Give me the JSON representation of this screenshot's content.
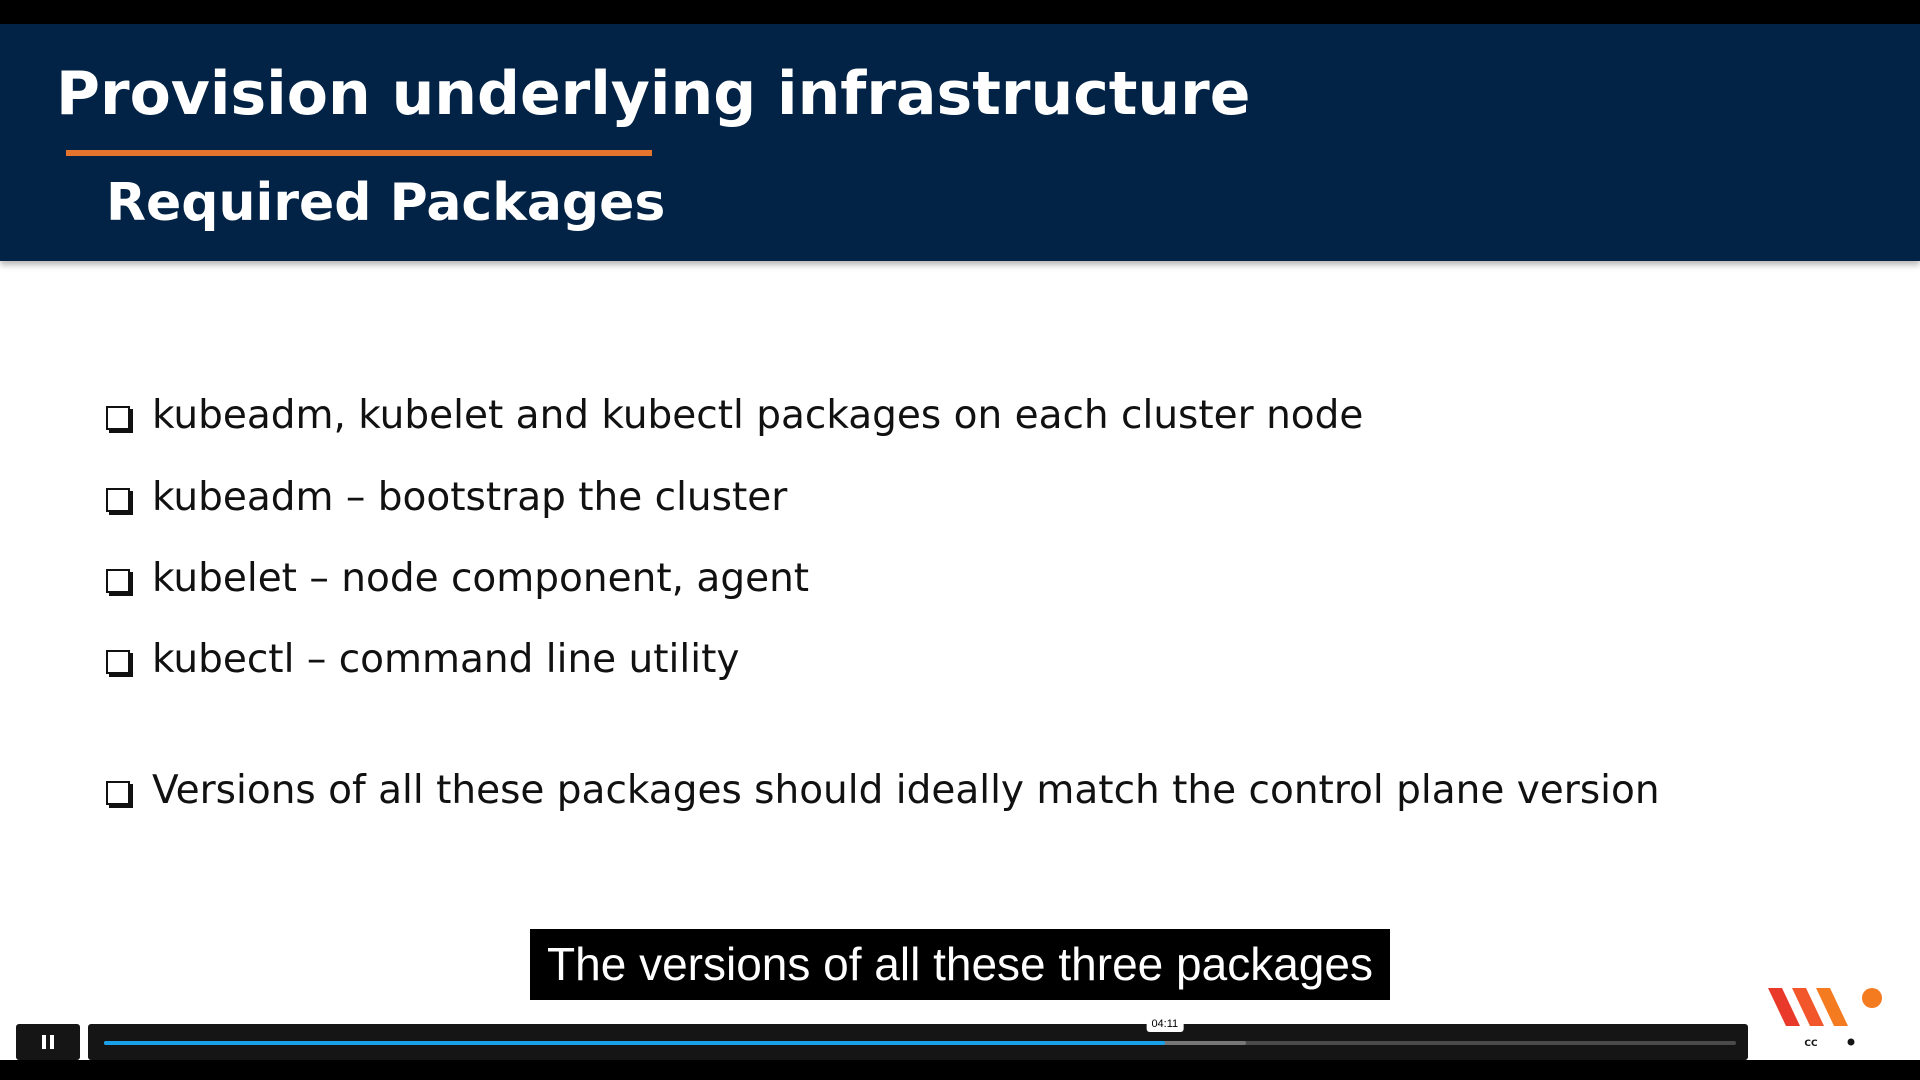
{
  "slide": {
    "title": "Provision underlying infrastructure",
    "subtitle": "Required Packages",
    "bullets": [
      "kubeadm, kubelet and kubectl packages on each cluster node",
      "kubeadm – bootstrap the cluster",
      "kubelet – node component, agent",
      "kubectl – command line utility",
      "Versions of all these packages should ideally match the control plane version"
    ]
  },
  "caption": {
    "text": "The versions of all these three packages"
  },
  "player": {
    "current_time": "04:11",
    "progress": 0.65,
    "buffered": 0.7,
    "icons": [
      "pause-icon",
      "volume-icon",
      "captions-icon",
      "settings-icon",
      "exit-fullscreen-icon"
    ]
  },
  "colors": {
    "header_bg": "#022345",
    "accent": "#e5752c",
    "progress": "#18a0e8",
    "logo_orange": "#f47b20",
    "logo_red": "#e8392b"
  }
}
